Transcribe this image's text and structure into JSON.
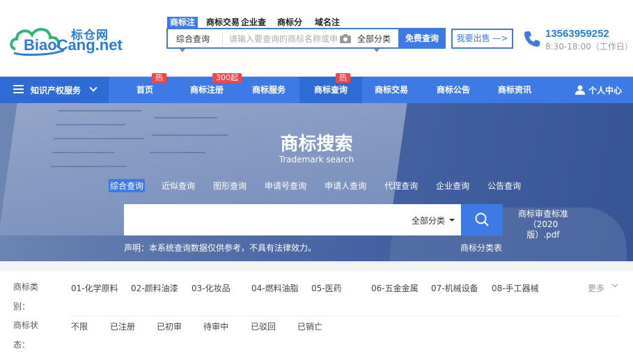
{
  "logo": {
    "cn": "标仓网",
    "en": "BiaoCang.net"
  },
  "header": {
    "tabs": [
      "商标注",
      "商标交易",
      "企业查",
      "商标分",
      "域名注"
    ],
    "search_type": "综合查询",
    "placeholder": "请输入要查询的商标名称或申",
    "category": "全部分类",
    "search_button": "免费查询",
    "sell_button": "我要出售 —>",
    "phone": "13563959252",
    "hours": "8:30-18:00（工作日）"
  },
  "nav": {
    "ipr_label": "知识产权服务",
    "items": [
      "首页",
      "商标注册",
      "商标服务",
      "商标查询",
      "商标交易",
      "商标公告",
      "商标资讯"
    ],
    "badges": {
      "home": "热",
      "register": "300起",
      "query": "热"
    },
    "user_center": "个人中心"
  },
  "hero": {
    "title": "商标搜索",
    "subtitle": "Trademark search",
    "tabs": [
      "综合查询",
      "近似查询",
      "图形查询",
      "申请号查询",
      "申请人查询",
      "代理查询",
      "企业查询",
      "公告查询"
    ],
    "category": "全部分类",
    "pdf_link": "商标审查标准（2020版）.pdf",
    "notice": "声明：本系统查询数据仅供参考，不具有法律效力。",
    "class_table": "商标分类表"
  },
  "filters": {
    "category_label": "商标类别：",
    "categories": [
      "01-化学原料",
      "02-颜料油漆",
      "03-化妆品",
      "04-燃料油脂",
      "05-医药",
      "06-五金金属",
      "07-机械设备",
      "08-手工器械"
    ],
    "more": "更多",
    "status_label": "商标状态：",
    "statuses": [
      "不限",
      "已注册",
      "已初审",
      "待审中",
      "已驳回",
      "已销亡"
    ]
  },
  "colors": {
    "primary": "#3d7ae6",
    "nav_dark": "#2f6bd4",
    "badge": "#f04848",
    "brand": "#2c7bdc"
  }
}
